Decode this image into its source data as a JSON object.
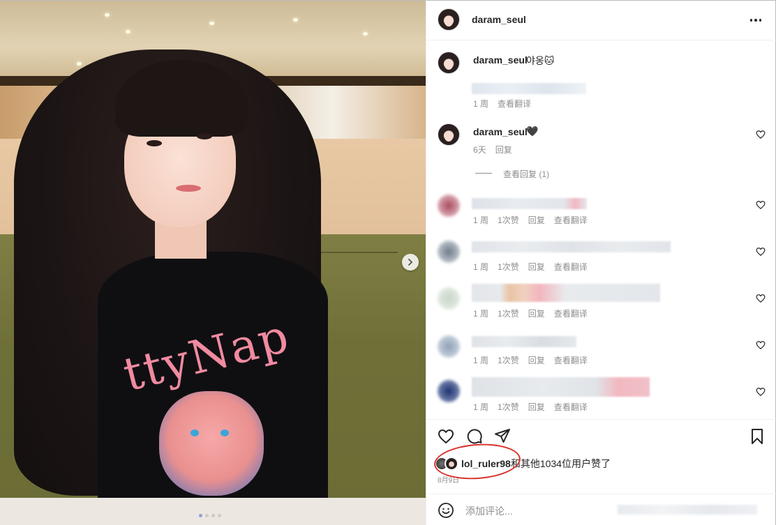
{
  "post": {
    "username": "daram_seul",
    "caption": {
      "username": "daram_seul",
      "text": "야옹🐱",
      "time": "1 周",
      "translate": "查看翻译"
    }
  },
  "comments": [
    {
      "username": "daram_seul",
      "text": "🖤",
      "time": "6天",
      "reply": "回复",
      "view_replies": "查看回复 (1)"
    },
    {
      "time": "1 周",
      "likes": "1次赞",
      "reply": "回复",
      "translate": "查看翻译"
    },
    {
      "time": "1 周",
      "likes": "1次赞",
      "reply": "回复",
      "translate": "查看翻译"
    },
    {
      "time": "1 周",
      "likes": "1次赞",
      "reply": "回复",
      "translate": "查看翻译"
    },
    {
      "time": "1 周",
      "likes": "1次赞",
      "reply": "回复",
      "translate": "查看翻译"
    },
    {
      "time": "1 周",
      "likes": "1次赞",
      "reply": "回复",
      "translate": "查看翻译"
    }
  ],
  "likes_summary": {
    "user": "lol_ruler98",
    "rest": "和其他1034位用户赞了"
  },
  "post_date": "8月9日",
  "compose": {
    "placeholder": "添加评论..."
  },
  "photo": {
    "shirt_text": "ttyNap",
    "carousel_current": 1,
    "carousel_total": 4
  },
  "icons": [
    "more-icon",
    "heart-icon",
    "comment-icon",
    "share-icon",
    "bookmark-icon",
    "emoji-icon",
    "next-icon"
  ],
  "colors": {
    "annotation_circle": "#d8332b",
    "meta_text": "#8e8e8e"
  }
}
